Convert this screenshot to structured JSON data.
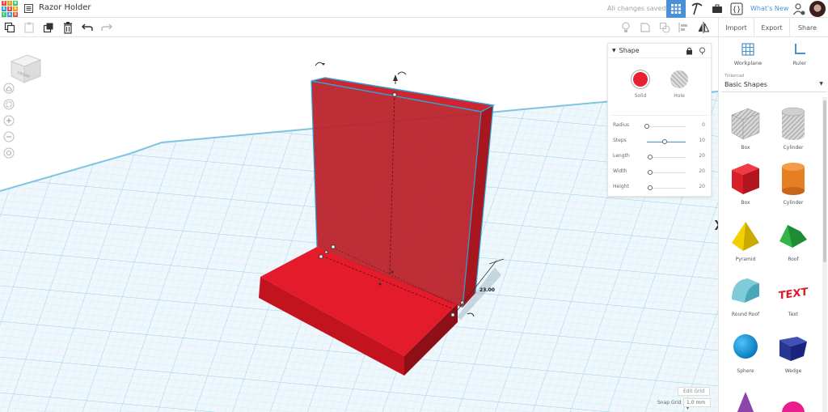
{
  "app": {
    "title": "Razor Holder",
    "save_status": "All changes saved",
    "whats_new": "What's New",
    "logo_letters": [
      "T",
      "I",
      "N",
      "K",
      "E",
      "R",
      "C",
      "A",
      "D"
    ]
  },
  "toolbar": {
    "import_label": "Import",
    "export_label": "Export",
    "share_label": "Share"
  },
  "viewcube": {
    "face_label": "FRONT"
  },
  "inspector": {
    "title": "Shape",
    "solid_label": "Solid",
    "hole_label": "Hole",
    "properties": [
      {
        "label": "Radius",
        "value": "0",
        "fraction": 0.0
      },
      {
        "label": "Steps",
        "value": "10",
        "fraction": 0.45
      },
      {
        "label": "Length",
        "value": "20",
        "fraction": 0.08
      },
      {
        "label": "Width",
        "value": "20",
        "fraction": 0.08
      },
      {
        "label": "Height",
        "value": "20",
        "fraction": 0.08
      }
    ]
  },
  "panel": {
    "workplane_label": "Workplane",
    "ruler_label": "Ruler",
    "library_source": "Tinkercad",
    "library_name": "Basic Shapes",
    "shapes": [
      {
        "label": "Box"
      },
      {
        "label": "Cylinder"
      },
      {
        "label": "Box"
      },
      {
        "label": "Cylinder"
      },
      {
        "label": "Pyramid"
      },
      {
        "label": "Roof"
      },
      {
        "label": "Round Roof"
      },
      {
        "label": "Text"
      },
      {
        "label": "Sphere"
      },
      {
        "label": "Wedge"
      }
    ]
  },
  "workplane": {
    "dimension_value": "23.00",
    "edit_grid_label": "Edit Grid",
    "snap_grid_label": "Snap Grid",
    "snap_grid_value": "1.0 mm ▾"
  },
  "colors": {
    "accent": "#4a90d9",
    "shape_red": "#e8202f",
    "grid_blue": "#8fc9e3"
  }
}
